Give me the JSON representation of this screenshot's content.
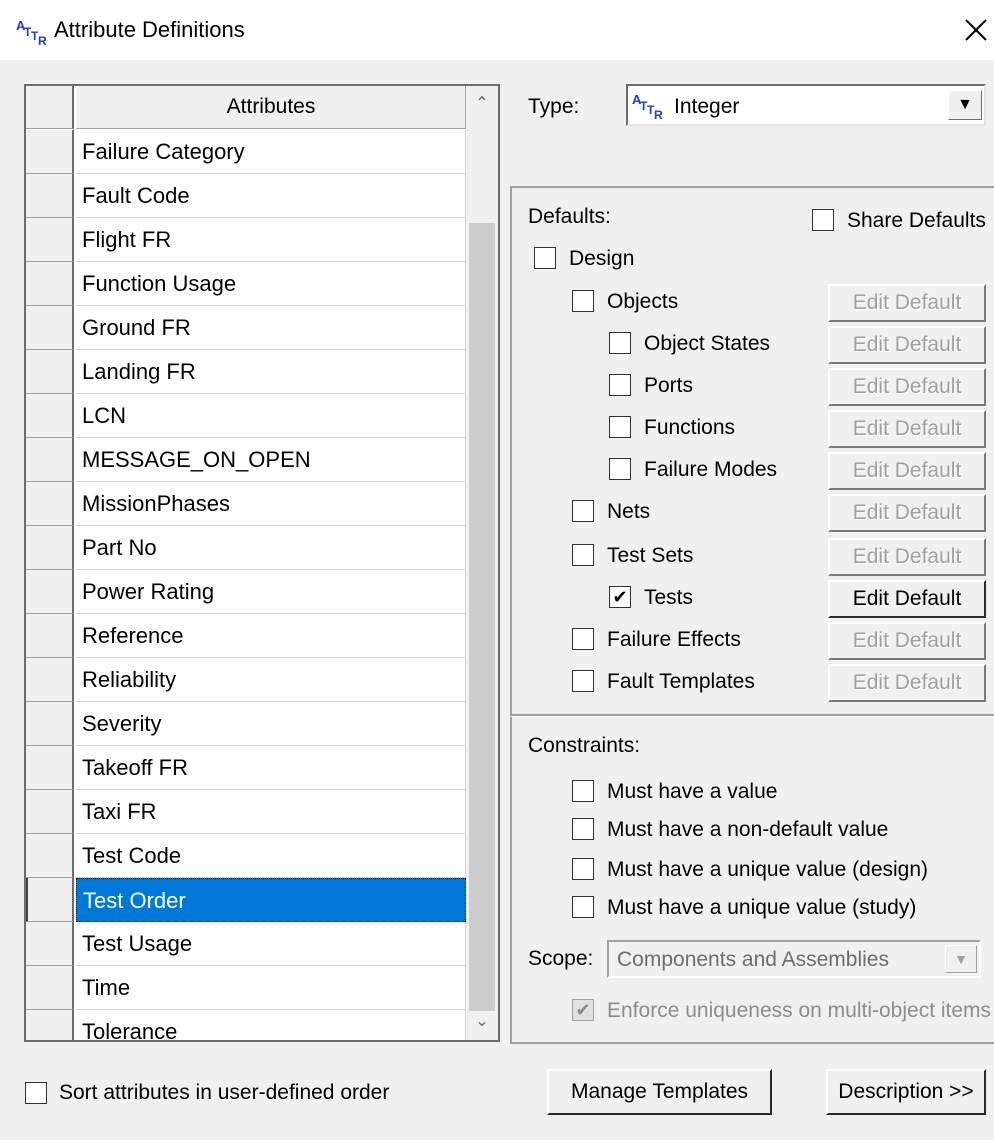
{
  "window": {
    "title": "Attribute Definitions",
    "icon": "attr-icon",
    "close_glyph": "✕"
  },
  "grid": {
    "header": "Attributes",
    "scroll_up_glyph": "⌃",
    "scroll_down_glyph": "⌄",
    "rows": [
      {
        "name": "Failure Category"
      },
      {
        "name": "Fault Code"
      },
      {
        "name": "Flight FR"
      },
      {
        "name": "Function Usage"
      },
      {
        "name": "Ground FR"
      },
      {
        "name": "Landing FR"
      },
      {
        "name": "LCN"
      },
      {
        "name": "MESSAGE_ON_OPEN"
      },
      {
        "name": "MissionPhases"
      },
      {
        "name": "Part No"
      },
      {
        "name": "Power Rating"
      },
      {
        "name": "Reference"
      },
      {
        "name": "Reliability"
      },
      {
        "name": "Severity"
      },
      {
        "name": "Takeoff FR"
      },
      {
        "name": "Taxi FR"
      },
      {
        "name": "Test Code"
      },
      {
        "name": "Test Order",
        "selected": true
      },
      {
        "name": "Test Usage"
      },
      {
        "name": "Time"
      },
      {
        "name": "Tolerance"
      }
    ]
  },
  "type": {
    "label": "Type:",
    "value": "Integer",
    "dropdown_glyph": "▼"
  },
  "defaults": {
    "label": "Defaults:",
    "share_defaults": {
      "label": "Share Defaults",
      "checked": false
    },
    "design": {
      "label": "Design",
      "checked": false
    },
    "edit_default_label": "Edit Default",
    "items": [
      {
        "label": "Objects",
        "checked": false,
        "level": 1,
        "edit_enabled": false
      },
      {
        "label": "Object States",
        "checked": false,
        "level": 2,
        "edit_enabled": false
      },
      {
        "label": "Ports",
        "checked": false,
        "level": 2,
        "edit_enabled": false
      },
      {
        "label": "Functions",
        "checked": false,
        "level": 2,
        "edit_enabled": false
      },
      {
        "label": "Failure Modes",
        "checked": false,
        "level": 2,
        "edit_enabled": false
      },
      {
        "label": "Nets",
        "checked": false,
        "level": 1,
        "edit_enabled": false
      },
      {
        "label": "Test Sets",
        "checked": false,
        "level": 1,
        "edit_enabled": false
      },
      {
        "label": "Tests",
        "checked": true,
        "level": 2,
        "edit_enabled": true
      },
      {
        "label": "Failure Effects",
        "checked": false,
        "level": 1,
        "edit_enabled": false
      },
      {
        "label": "Fault Templates",
        "checked": false,
        "level": 1,
        "edit_enabled": false
      }
    ]
  },
  "constraints": {
    "label": "Constraints:",
    "items": [
      {
        "label": "Must have a value",
        "checked": false
      },
      {
        "label": "Must have a non-default value",
        "checked": false
      },
      {
        "label": "Must have a unique value (design)",
        "checked": false
      },
      {
        "label": "Must have a unique value (study)",
        "checked": false
      }
    ],
    "scope": {
      "label": "Scope:",
      "value": "Components and Assemblies",
      "dropdown_glyph": "▼"
    },
    "enforce": {
      "label": "Enforce uniqueness on multi-object items",
      "checked": true,
      "disabled": true
    }
  },
  "footer": {
    "sort_checkbox": {
      "label": "Sort attributes in user-defined order",
      "checked": false
    },
    "manage_templates": "Manage Templates",
    "description": "Description >>"
  },
  "colors": {
    "selection": "#0078d7",
    "background": "#f0f0f0"
  }
}
